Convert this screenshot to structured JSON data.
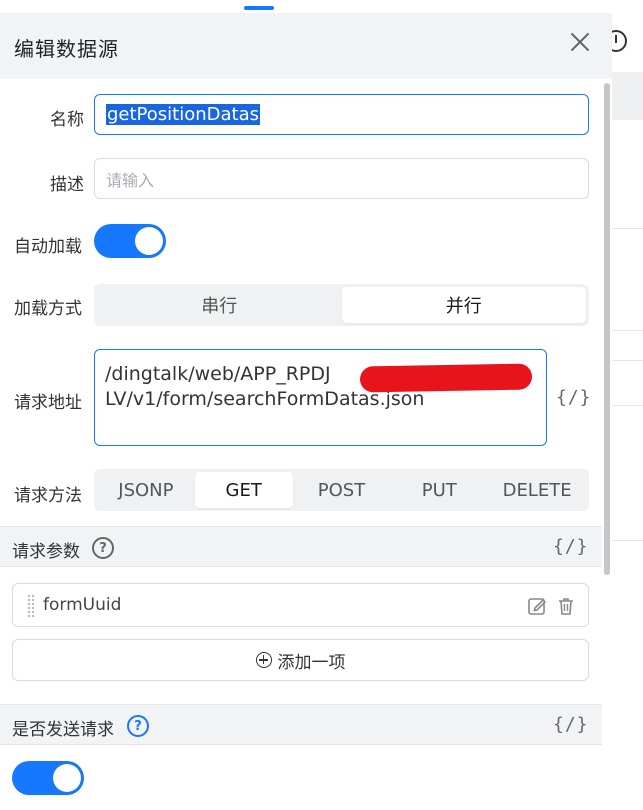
{
  "dialog": {
    "title": "编辑数据源"
  },
  "form": {
    "name": {
      "label": "名称",
      "value": "getPositionDatas"
    },
    "description": {
      "label": "描述",
      "placeholder": "请输入"
    },
    "auto_load": {
      "label": "自动加载",
      "on": true
    },
    "load_mode": {
      "label": "加载方式",
      "options": [
        "串行",
        "并行"
      ],
      "selected": "并行"
    },
    "request_url": {
      "label": "请求地址",
      "line1": "/dingtalk/web/APP_RPDJ",
      "line2": "LV/v1/form/searchFormDatas.json",
      "code_icon": "{/}"
    },
    "request_method": {
      "label": "请求方法",
      "options": [
        "JSONP",
        "GET",
        "POST",
        "PUT",
        "DELETE"
      ],
      "selected": "GET"
    }
  },
  "params_section": {
    "title": "请求参数",
    "help_icon": "?",
    "code_icon": "{/}",
    "items": [
      {
        "name": "formUuid"
      }
    ],
    "add_label": "添加一项"
  },
  "send_section": {
    "title": "是否发送请求",
    "help_icon": "?",
    "code_icon": "{/}",
    "on": true
  },
  "icons": {
    "edit": "edit-icon",
    "delete": "trash-icon",
    "close": "close-icon",
    "history": "clock-icon"
  },
  "colors": {
    "primary": "#1677ff",
    "redaction": "#e8141c"
  }
}
